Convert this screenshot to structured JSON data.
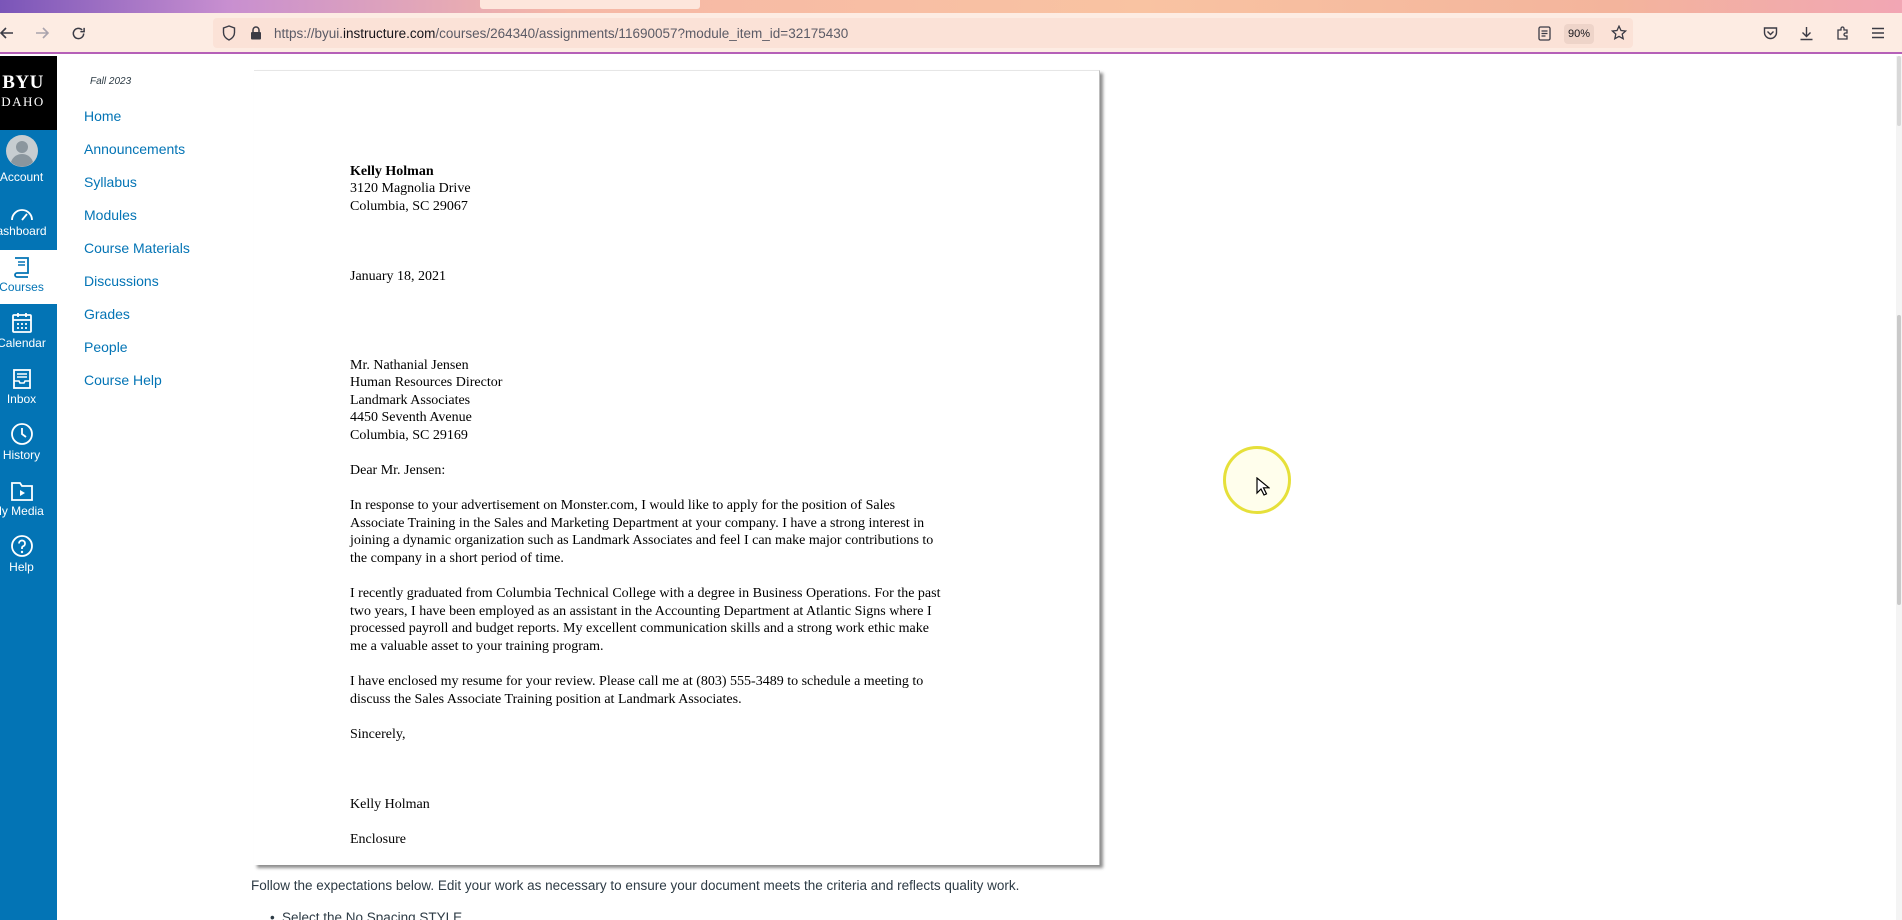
{
  "browser": {
    "url_prefix": "https://byui.",
    "url_domain": "instructure.com",
    "url_path": "/courses/264340/assignments/11690057?module_item_id=32175430",
    "zoom": "90%"
  },
  "global_nav": {
    "logo_top": "BYU",
    "logo_bottom": "DAHO",
    "items": [
      {
        "label": "Account",
        "icon": "account-avatar-icon"
      },
      {
        "label": "ashboard",
        "icon": "dashboard-icon"
      },
      {
        "label": "Courses",
        "icon": "courses-icon"
      },
      {
        "label": "Calendar",
        "icon": "calendar-icon"
      },
      {
        "label": "Inbox",
        "icon": "inbox-icon"
      },
      {
        "label": "History",
        "icon": "history-icon"
      },
      {
        "label": "ly Media",
        "icon": "my-media-icon"
      },
      {
        "label": "Help",
        "icon": "help-icon"
      }
    ]
  },
  "course_nav": {
    "term": "Fall 2023",
    "links": [
      "Home",
      "Announcements",
      "Syllabus",
      "Modules",
      "Course Materials",
      "Discussions",
      "Grades",
      "People",
      "Course Help"
    ]
  },
  "letter": {
    "sender_name": "Kelly Holman",
    "sender_street": "3120 Magnolia Drive",
    "sender_city": "Columbia, SC 29067",
    "date": "January 18, 2021",
    "recipient": [
      "Mr. Nathanial Jensen",
      "Human Resources Director",
      "Landmark Associates",
      "4450 Seventh Avenue",
      "Columbia, SC 29169"
    ],
    "salutation": "Dear Mr. Jensen:",
    "para1": [
      "In response to your advertisement on Monster.com, I would like to apply for the position of Sales",
      "Associate Training in the Sales and Marketing Department at your company.  I have a strong interest in",
      "joining a dynamic organization such as Landmark Associates and feel I can make major contributions to",
      "the company in a short period of time."
    ],
    "para2": [
      "I recently graduated from Columbia Technical College with a degree in Business Operations.  For the past",
      "two years, I have been employed as an assistant in the Accounting Department at Atlantic Signs where I",
      "processed payroll and budget reports.  My excellent communication skills and a strong work ethic make",
      "me a valuable asset to your training program."
    ],
    "para3": [
      "I have enclosed my resume for your review.  Please call me at (803) 555-3489 to schedule a meeting to",
      "discuss the Sales Associate Training position at Landmark Associates."
    ],
    "closing": "Sincerely,",
    "signature": "Kelly Holman",
    "enclosure": "Enclosure"
  },
  "instructions": {
    "text": "Follow the expectations below. Edit your work as necessary to ensure your document meets the criteria and reflects quality work.",
    "first_item": "Select the No Spacing STYLE"
  },
  "colors": {
    "canvas_blue": "#0374b5",
    "link_blue": "#0374b5",
    "cursor_highlight": "#e6e03a"
  }
}
